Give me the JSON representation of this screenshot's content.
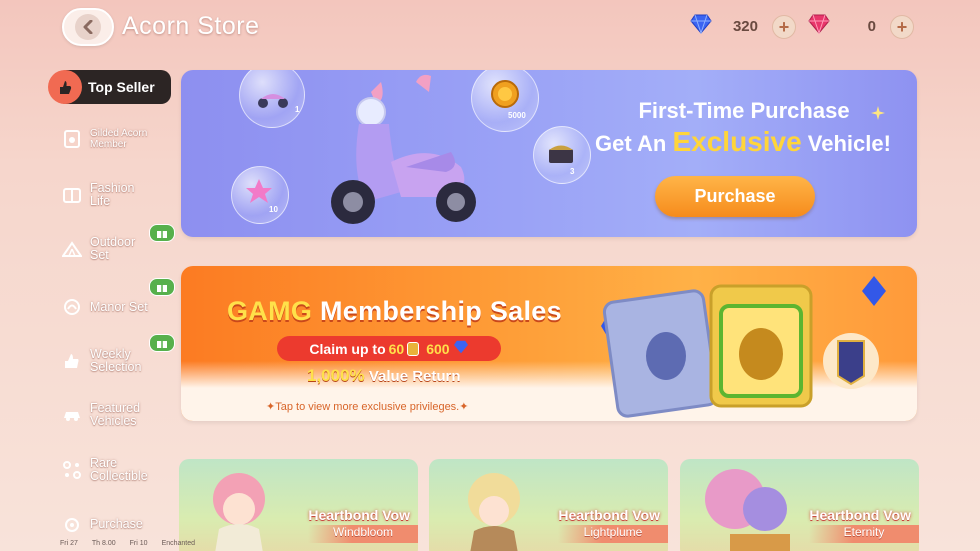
{
  "header": {
    "title": "Acorn Store",
    "blue_gem_amount": "320",
    "pink_gem_amount": "0"
  },
  "sidebar": {
    "items": [
      {
        "label": "Top Seller",
        "icon": "flame-hand-icon",
        "active": true
      },
      {
        "label": "Gilded Acorn Member",
        "icon": "acorn-card-icon"
      },
      {
        "label": "Fashion Life",
        "icon": "wardrobe-icon"
      },
      {
        "label": "Outdoor Set",
        "icon": "tent-icon",
        "badge": "gift"
      },
      {
        "label": "Manor Set",
        "icon": "manor-icon",
        "badge": "gift"
      },
      {
        "label": "Weekly Selection",
        "icon": "thumbs-up-icon",
        "badge": "gift"
      },
      {
        "label": "Featured Vehicles",
        "icon": "car-icon"
      },
      {
        "label": "Rare Collectible",
        "icon": "sparkle-icon"
      },
      {
        "label": "Purchase",
        "icon": "bag-icon"
      }
    ]
  },
  "banner1": {
    "line1": "First-Time Purchase",
    "line2_prefix": "Get An",
    "line2_highlight": "Exclusive",
    "line2_suffix": "Vehicle!",
    "button": "Purchase",
    "bubbles": {
      "scooter": "1",
      "coin": "5000",
      "chest": "3",
      "star": "10"
    }
  },
  "banner2": {
    "title_highlight": "GAMG",
    "title_rest": "Membership Sales",
    "claim_prefix": "Claim up to",
    "claim_num1": "60",
    "claim_num2": "600",
    "value_pct": "1,000%",
    "value_rest": "Value Return",
    "note": "Tap to view more exclusive privileges."
  },
  "cards": [
    {
      "title": "Heartbond Vow",
      "sub": "Windbloom"
    },
    {
      "title": "Heartbond Vow",
      "sub": "Lightplume"
    },
    {
      "title": "Heartbond Vow",
      "sub": "Eternity"
    }
  ],
  "bottom_strip": [
    "Fri 27",
    "Th 8.00",
    "Fri 10",
    "Enchanted"
  ],
  "colors": {
    "accent_orange": "#f68b1c",
    "banner1_purple": "#9aa2f6",
    "sidebar_active": "#2c2524",
    "gift_green": "#57b04c"
  }
}
